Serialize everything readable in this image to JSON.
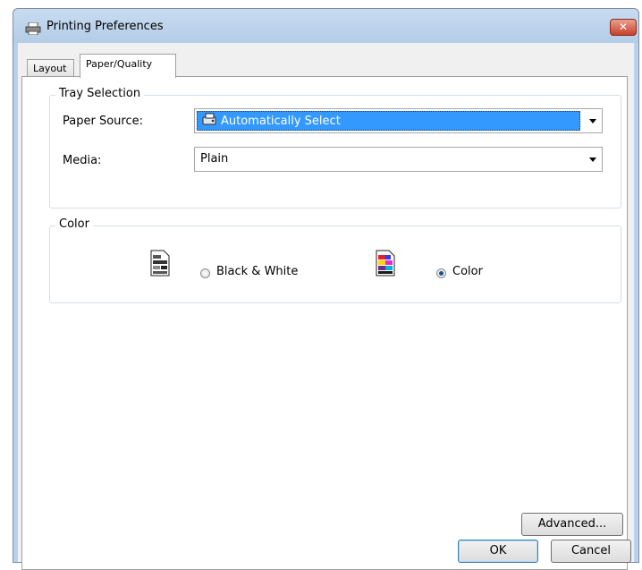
{
  "window": {
    "title": "Printing Preferences",
    "close_label": "✕"
  },
  "tabs": [
    {
      "label": "Layout",
      "active": false
    },
    {
      "label": "Paper/Quality",
      "active": true
    }
  ],
  "tray_selection": {
    "group_label": "Tray Selection",
    "paper_source_label": "Paper Source:",
    "paper_source_value": "Automatically Select",
    "media_label": "Media:",
    "media_value": "Plain"
  },
  "color": {
    "group_label": "Color",
    "bw_label": "Black & White",
    "color_label": "Color",
    "selected": "Color"
  },
  "buttons": {
    "advanced": "Advanced...",
    "ok": "OK",
    "cancel": "Cancel"
  },
  "icons": {
    "printer": "printer-icon",
    "paper_source": "paper-tray-icon",
    "bw_document": "grayscale-document-icon",
    "color_document": "color-document-icon",
    "dropdown": "chevron-down-icon"
  },
  "colors": {
    "selection": "#3399ff",
    "title_bar": "#b9d1ea",
    "close_button": "#c9402a"
  }
}
